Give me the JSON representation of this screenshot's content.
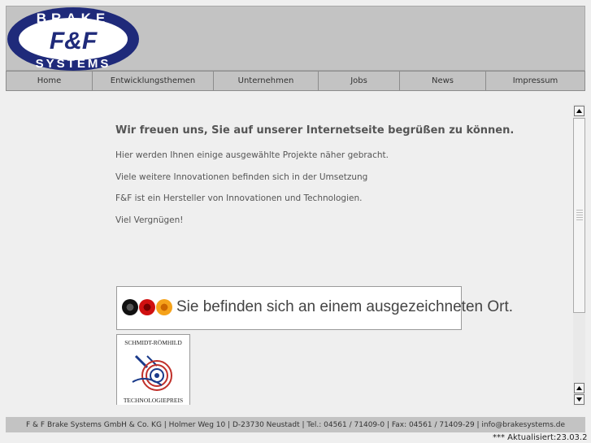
{
  "logo": {
    "top_text": "BRAKE",
    "center_text": "F&F",
    "bottom_text": "SYSTEMS"
  },
  "nav": {
    "items": [
      {
        "label": "Home"
      },
      {
        "label": "Entwicklungsthemen"
      },
      {
        "label": "Unternehmen"
      },
      {
        "label": "Jobs"
      },
      {
        "label": "News"
      },
      {
        "label": "Impressum"
      }
    ]
  },
  "content": {
    "headline": "Wir freuen uns, Sie auf unserer Internetseite begrüßen zu können.",
    "paragraphs": [
      "Hier werden Ihnen einige ausgewählte Projekte näher gebracht.",
      "Viele weitere Innovationen befinden sich in der Umsetzung",
      "F&F ist ein Hersteller von Innovationen und Technologien.",
      "Viel Vergnügen!"
    ],
    "banner_text": "Sie befinden sich an einem ausgezeichneten Ort.",
    "award": {
      "top": "SCHMIDT-RÖMHILD",
      "bottom": "TECHNOLOGIEPREIS"
    }
  },
  "footer": {
    "text": "F & F Brake Systems GmbH & Co. KG | Holmer Weg 10 | D-23730 Neustadt | Tel.: 04561 / 71409-0 | Fax: 04561 / 71409-29 | info@brakesystems.de",
    "updated": "*** Aktualisiert:23.03.2"
  },
  "colors": {
    "logo_blue": "#1f2a7a",
    "background": "#efefef",
    "bar_gray": "#c3c3c3"
  }
}
